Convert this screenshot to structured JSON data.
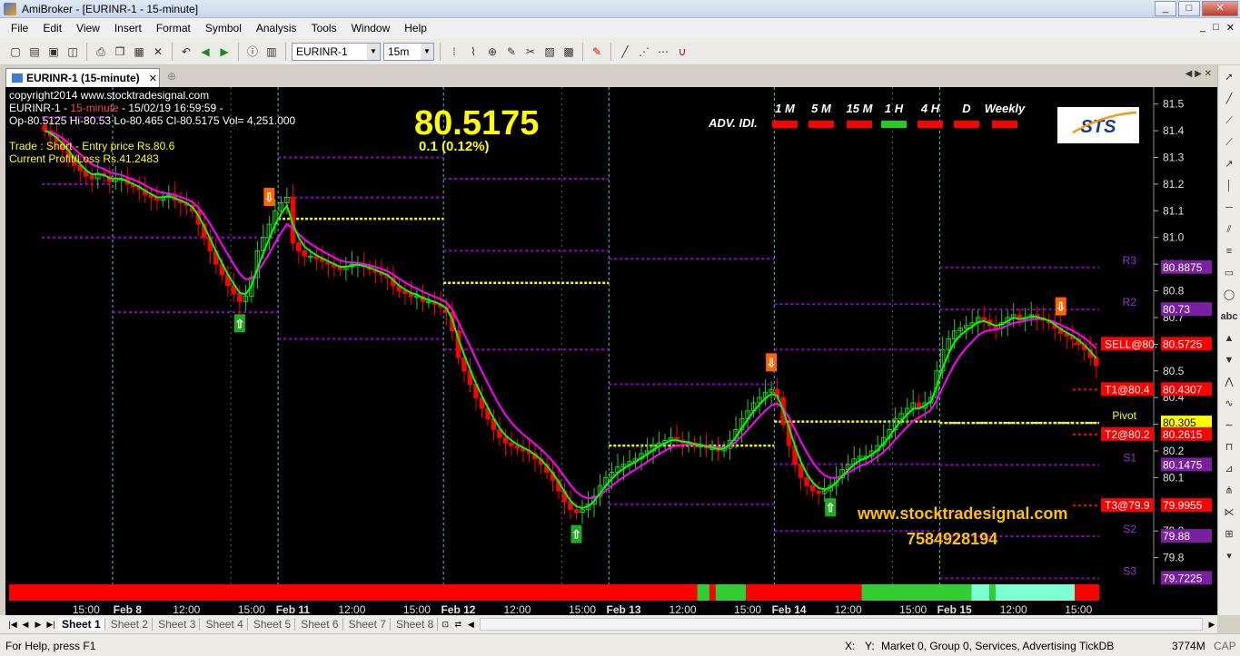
{
  "window": {
    "title": "AmiBroker - [EURINR-1 - 15-minute]",
    "buttons": [
      "_",
      "□",
      "✕"
    ]
  },
  "menu": {
    "items": [
      "File",
      "Edit",
      "View",
      "Insert",
      "Format",
      "Symbol",
      "Analysis",
      "Tools",
      "Window",
      "Help"
    ],
    "right_controls": [
      "_",
      "□",
      "✕"
    ]
  },
  "toolbar": {
    "symbol": "EURINR-1",
    "interval": "15m"
  },
  "tab": {
    "label": "EURINR-1 (15-minute)",
    "close": "✕"
  },
  "sheets": [
    "Sheet 1",
    "Sheet 2",
    "Sheet 3",
    "Sheet 4",
    "Sheet 5",
    "Sheet 6",
    "Sheet 7",
    "Sheet 8"
  ],
  "status": {
    "help": "For Help, press F1",
    "x": "X:",
    "y": "Y:",
    "market": "Market 0, Group 0, Services, Advertising",
    "db": "TickDB",
    "memory": "3774M",
    "caps": "CAP"
  },
  "colors": {
    "background": "#000000",
    "candle_up": "#22cc22",
    "candle_down": "#ff0000",
    "fast_ma": "#00ff00",
    "slow_ma": "#ff00ff",
    "pivot_line": "#ffff00",
    "sr_line": "#9900cc",
    "trend_red": "#ff0000",
    "trend_green": "#33cc33",
    "trend_aqua": "#7fffd4"
  },
  "chart_data": {
    "type": "line",
    "info_lines": [
      "copyright2014 www.stocktradesignal.com",
      "EURINR-1 - ",
      "15-minute",
      " - 15/02/19 16:59:59 -",
      "Op-80.5125  Hi-80.53  Lo-80.465  Cl-80.5175  Vol= 4,251.000",
      "Trade : Short - Entry price Rs.80.6",
      "Current Profit/Loss Rs.41.2483"
    ],
    "price_big": "80.5175",
    "change": "0.1 (0.12%)",
    "adv_label": "ADV. IDI.",
    "timeframes": [
      {
        "label": "1 M",
        "color": "#ff0000"
      },
      {
        "label": "5 M",
        "color": "#ff0000"
      },
      {
        "label": "15 M",
        "color": "#ff0000"
      },
      {
        "label": "1 H",
        "color": "#22cc22"
      },
      {
        "label": "4 H",
        "color": "#ff0000"
      },
      {
        "label": "D",
        "color": "#ff0000"
      },
      {
        "label": "Weekly",
        "color": "#ff0000"
      }
    ],
    "logo": "STS",
    "website": "www.stocktradesignal.com",
    "phone": "7584928194",
    "ylim": [
      79.7,
      81.55
    ],
    "y_ticks": [
      81.5,
      81.4,
      81.3,
      81.2,
      81.1,
      81.0,
      80.9,
      80.8,
      80.7,
      80.6,
      80.5,
      80.4,
      80.3,
      80.2,
      80.1,
      79.9,
      79.8
    ],
    "x_ticks": [
      {
        "label": "15:00",
        "bar": 7
      },
      {
        "label": "Feb 8",
        "bar": 14,
        "bold": true
      },
      {
        "label": "12:00",
        "bar": 24
      },
      {
        "label": "15:00",
        "bar": 35
      },
      {
        "label": "Feb 11",
        "bar": 42,
        "bold": true
      },
      {
        "label": "12:00",
        "bar": 52
      },
      {
        "label": "15:00",
        "bar": 63
      },
      {
        "label": "Feb 12",
        "bar": 70,
        "bold": true
      },
      {
        "label": "12:00",
        "bar": 80
      },
      {
        "label": "15:00",
        "bar": 91
      },
      {
        "label": "Feb 13",
        "bar": 98,
        "bold": true
      },
      {
        "label": "12:00",
        "bar": 108
      },
      {
        "label": "15:00",
        "bar": 119
      },
      {
        "label": "Feb 14",
        "bar": 126,
        "bold": true
      },
      {
        "label": "12:00",
        "bar": 136
      },
      {
        "label": "15:00",
        "bar": 147
      },
      {
        "label": "Feb 15",
        "bar": 154,
        "bold": true
      },
      {
        "label": "12:00",
        "bar": 164
      },
      {
        "label": "15:00",
        "bar": 175
      }
    ],
    "day_separators": [
      12,
      40,
      68,
      96,
      124,
      152
    ],
    "hour_separators": [
      32,
      88,
      144
    ],
    "closes": [
      81.4,
      81.38,
      81.36,
      81.33,
      81.3,
      81.27,
      81.25,
      81.23,
      81.22,
      81.24,
      81.23,
      81.21,
      81.22,
      81.22,
      81.2,
      81.19,
      81.18,
      81.16,
      81.15,
      81.14,
      81.15,
      81.16,
      81.14,
      81.13,
      81.12,
      81.1,
      81.05,
      81.0,
      80.95,
      80.9,
      80.86,
      80.82,
      80.79,
      80.76,
      80.78,
      80.85,
      80.95,
      81.0,
      81.05,
      81.1,
      81.13,
      81.15,
      80.98,
      80.95,
      80.93,
      80.93,
      80.92,
      80.91,
      80.9,
      80.89,
      80.88,
      80.89,
      80.9,
      80.9,
      80.89,
      80.88,
      80.87,
      80.86,
      80.85,
      80.82,
      80.8,
      80.79,
      80.78,
      80.78,
      80.76,
      80.76,
      80.75,
      80.74,
      80.72,
      80.65,
      80.55,
      80.5,
      80.45,
      80.4,
      80.36,
      80.32,
      80.28,
      80.25,
      80.23,
      80.22,
      80.21,
      80.2,
      80.19,
      80.17,
      80.15,
      80.12,
      80.09,
      80.05,
      80.01,
      79.98,
      79.97,
      79.98,
      80.0,
      80.03,
      80.07,
      80.1,
      80.12,
      80.14,
      80.15,
      80.16,
      80.17,
      80.19,
      80.2,
      80.22,
      80.23,
      80.24,
      80.25,
      80.24,
      80.23,
      80.23,
      80.22,
      80.22,
      80.21,
      80.21,
      80.2,
      80.21,
      80.24,
      80.28,
      80.32,
      80.35,
      80.38,
      80.4,
      80.42,
      80.43,
      80.4,
      80.3,
      80.22,
      80.15,
      80.1,
      80.07,
      80.05,
      80.04,
      80.05,
      80.07,
      80.1,
      80.13,
      80.15,
      80.17,
      80.18,
      80.18,
      80.2,
      80.22,
      80.25,
      80.28,
      80.32,
      80.34,
      80.36,
      80.38,
      80.36,
      80.38,
      80.4,
      80.5,
      80.58,
      80.62,
      80.65,
      80.66,
      80.67,
      80.68,
      80.7,
      80.69,
      80.67,
      80.66,
      80.68,
      80.7,
      80.71,
      80.69,
      80.7,
      80.71,
      80.7,
      80.69,
      80.68,
      80.66,
      80.64,
      80.63,
      80.62,
      80.6,
      80.58,
      80.55,
      80.52
    ],
    "levels": [
      {
        "label": "R3",
        "value": 80.8875,
        "value_text": "80.8875",
        "color": "#9900cc"
      },
      {
        "label": "R2",
        "value": 80.73,
        "value_text": "80.73",
        "color": "#9900cc"
      },
      {
        "label": "SELL@80.",
        "value": 80.6,
        "value_text": "80.5725",
        "color": "#ff0000"
      },
      {
        "label": "T1@80.4",
        "value": 80.43,
        "value_text": "80.4307",
        "color": "#ff0000"
      },
      {
        "label": "Pivot",
        "value": 80.305,
        "value_text": "80.305",
        "color": "#ffff00"
      },
      {
        "label": "T2@80.2",
        "value": 80.2615,
        "value_text": "80.2615",
        "color": "#ff0000"
      },
      {
        "label": "S1",
        "value": 80.1475,
        "value_text": "80.1475",
        "color": "#9900cc"
      },
      {
        "label": "T3@79.9",
        "value": 79.9955,
        "value_text": "79.9955",
        "color": "#ff0000"
      },
      {
        "label": "S2",
        "value": 79.88,
        "value_text": "79.88",
        "color": "#9900cc"
      },
      {
        "label": "S3",
        "value": 79.7225,
        "value_text": "79.7225",
        "color": "#9900cc"
      }
    ],
    "signals": [
      {
        "bar": 33,
        "type": "buy"
      },
      {
        "bar": 38,
        "type": "sell"
      },
      {
        "bar": 90,
        "type": "buy"
      },
      {
        "bar": 123,
        "type": "sell"
      },
      {
        "bar": 133,
        "type": "buy"
      },
      {
        "bar": 172,
        "type": "sell"
      }
    ],
    "trend_bar": [
      {
        "from": 0,
        "to": 113,
        "color": "#ff0000"
      },
      {
        "from": 113,
        "to": 115,
        "color": "#33cc33"
      },
      {
        "from": 115,
        "to": 116,
        "color": "#ff0000"
      },
      {
        "from": 116,
        "to": 121,
        "color": "#33cc33"
      },
      {
        "from": 121,
        "to": 140,
        "color": "#ff0000"
      },
      {
        "from": 140,
        "to": 158,
        "color": "#33cc33"
      },
      {
        "from": 158,
        "to": 161,
        "color": "#7fffd4"
      },
      {
        "from": 161,
        "to": 162,
        "color": "#33cc33"
      },
      {
        "from": 162,
        "to": 175,
        "color": "#7fffd4"
      },
      {
        "from": 175,
        "to": 179,
        "color": "#ff0000"
      }
    ]
  }
}
